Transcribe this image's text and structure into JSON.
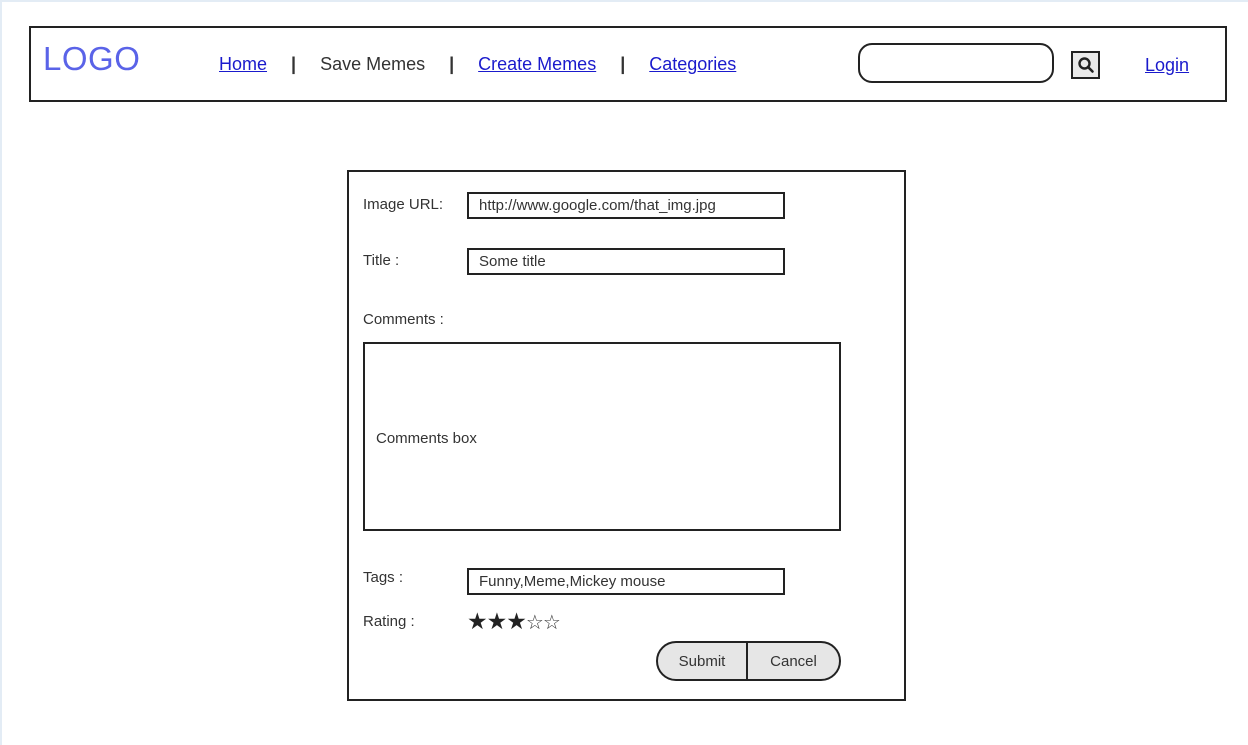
{
  "header": {
    "logo": "LOGO",
    "nav": {
      "home": "Home",
      "save_memes": "Save Memes",
      "create_memes": "Create Memes",
      "categories": "Categories",
      "separator": "|"
    },
    "search": {
      "value": "",
      "icon": "search-icon"
    },
    "login": "Login"
  },
  "form": {
    "image_url_label": "Image URL:",
    "image_url_value": "http://www.google.com/that_img.jpg",
    "title_label": "Title :",
    "title_value": "Some title",
    "comments_label": "Comments :",
    "comments_placeholder": "Comments box",
    "tags_label": "Tags :",
    "tags_value": "Funny,Meme,Mickey mouse",
    "rating_label": "Rating :",
    "rating": {
      "value": 3,
      "max": 5
    },
    "submit_label": "Submit",
    "cancel_label": "Cancel"
  },
  "colors": {
    "logo": "#5a63e8",
    "link": "#1a1acc",
    "border": "#222222",
    "button_bg": "#e6e6e6"
  }
}
